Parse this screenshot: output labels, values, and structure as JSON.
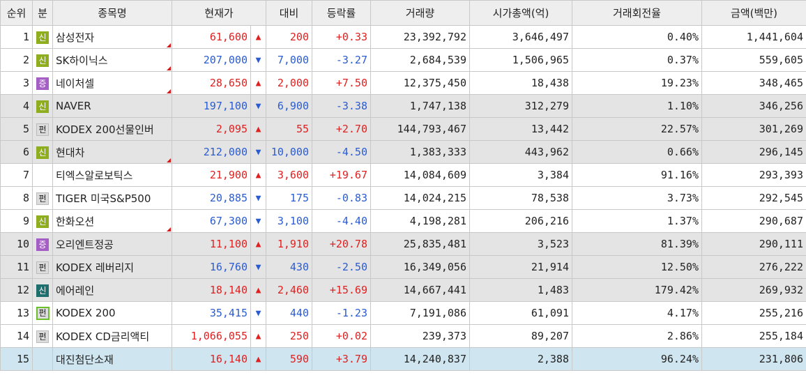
{
  "headers": [
    "순위",
    "분",
    "종목명",
    "현재가",
    "대비",
    "등락률",
    "거래량",
    "시가총액(억)",
    "거래회전율",
    "금액(백만)"
  ],
  "rows": [
    {
      "rank": "1",
      "type": "신",
      "name": "삼성전자",
      "price": "61,600",
      "arrow": "▲",
      "diff": "200",
      "rate": "+0.33",
      "volume": "23,392,792",
      "cap": "3,646,497",
      "turnover": "0.40%",
      "amount": "1,441,604"
    },
    {
      "rank": "2",
      "type": "신",
      "name": "SK하이닉스",
      "price": "207,000",
      "arrow": "▼",
      "diff": "7,000",
      "rate": "-3.27",
      "volume": "2,684,539",
      "cap": "1,506,965",
      "turnover": "0.37%",
      "amount": "559,605"
    },
    {
      "rank": "3",
      "type": "증",
      "name": "네이처셀",
      "price": "28,650",
      "arrow": "▲",
      "diff": "2,000",
      "rate": "+7.50",
      "volume": "12,375,450",
      "cap": "18,438",
      "turnover": "19.23%",
      "amount": "348,465"
    },
    {
      "rank": "4",
      "type": "신",
      "name": "NAVER",
      "price": "197,100",
      "arrow": "▼",
      "diff": "6,900",
      "rate": "-3.38",
      "volume": "1,747,138",
      "cap": "312,279",
      "turnover": "1.10%",
      "amount": "346,256"
    },
    {
      "rank": "5",
      "type": "펀",
      "name": "KODEX 200선물인버",
      "price": "2,095",
      "arrow": "▲",
      "diff": "55",
      "rate": "+2.70",
      "volume": "144,793,467",
      "cap": "13,442",
      "turnover": "22.57%",
      "amount": "301,269"
    },
    {
      "rank": "6",
      "type": "신",
      "name": "현대차",
      "price": "212,000",
      "arrow": "▼",
      "diff": "10,000",
      "rate": "-4.50",
      "volume": "1,383,333",
      "cap": "443,962",
      "turnover": "0.66%",
      "amount": "296,145"
    },
    {
      "rank": "7",
      "type": "",
      "name": "티엑스알로보틱스",
      "price": "21,900",
      "arrow": "▲",
      "diff": "3,600",
      "rate": "+19.67",
      "volume": "14,084,609",
      "cap": "3,384",
      "turnover": "91.16%",
      "amount": "293,393"
    },
    {
      "rank": "8",
      "type": "펀",
      "name": "TIGER 미국S&P500",
      "price": "20,885",
      "arrow": "▼",
      "diff": "175",
      "rate": "-0.83",
      "volume": "14,024,215",
      "cap": "78,538",
      "turnover": "3.73%",
      "amount": "292,545"
    },
    {
      "rank": "9",
      "type": "신",
      "name": "한화오션",
      "price": "67,300",
      "arrow": "▼",
      "diff": "3,100",
      "rate": "-4.40",
      "volume": "4,198,281",
      "cap": "206,216",
      "turnover": "1.37%",
      "amount": "290,687"
    },
    {
      "rank": "10",
      "type": "증",
      "name": "오리엔트정공",
      "price": "11,100",
      "arrow": "▲",
      "diff": "1,910",
      "rate": "+20.78",
      "volume": "25,835,481",
      "cap": "3,523",
      "turnover": "81.39%",
      "amount": "290,111"
    },
    {
      "rank": "11",
      "type": "펀",
      "name": "KODEX 레버리지",
      "price": "16,760",
      "arrow": "▼",
      "diff": "430",
      "rate": "-2.50",
      "volume": "16,349,056",
      "cap": "21,914",
      "turnover": "12.50%",
      "amount": "276,222"
    },
    {
      "rank": "12",
      "type": "신",
      "name": "에어레인",
      "price": "18,140",
      "arrow": "▲",
      "diff": "2,460",
      "rate": "+15.69",
      "volume": "14,667,441",
      "cap": "1,483",
      "turnover": "179.42%",
      "amount": "269,932"
    },
    {
      "rank": "13",
      "type": "펀",
      "name": "KODEX 200",
      "price": "35,415",
      "arrow": "▼",
      "diff": "440",
      "rate": "-1.23",
      "volume": "7,191,086",
      "cap": "61,091",
      "turnover": "4.17%",
      "amount": "255,216"
    },
    {
      "rank": "14",
      "type": "펀",
      "name": "KODEX CD금리액티",
      "price": "1,066,055",
      "arrow": "▲",
      "diff": "250",
      "rate": "+0.02",
      "volume": "239,373",
      "cap": "89,207",
      "turnover": "2.86%",
      "amount": "255,184"
    },
    {
      "rank": "15",
      "type": "",
      "name": "대진첨단소재",
      "price": "16,140",
      "arrow": "▲",
      "diff": "590",
      "rate": "+3.79",
      "volume": "14,240,837",
      "cap": "2,388",
      "turnover": "96.24%",
      "amount": "231,806"
    }
  ],
  "colors": {
    "up": "#e02020",
    "down": "#2a5bd0",
    "header_bg": "#eeeeee",
    "group_bg": "#e4e4e4",
    "selected_bg": "#cfe6f0",
    "badge_sin": "#8fae1f",
    "badge_jeung": "#a55fc4"
  }
}
